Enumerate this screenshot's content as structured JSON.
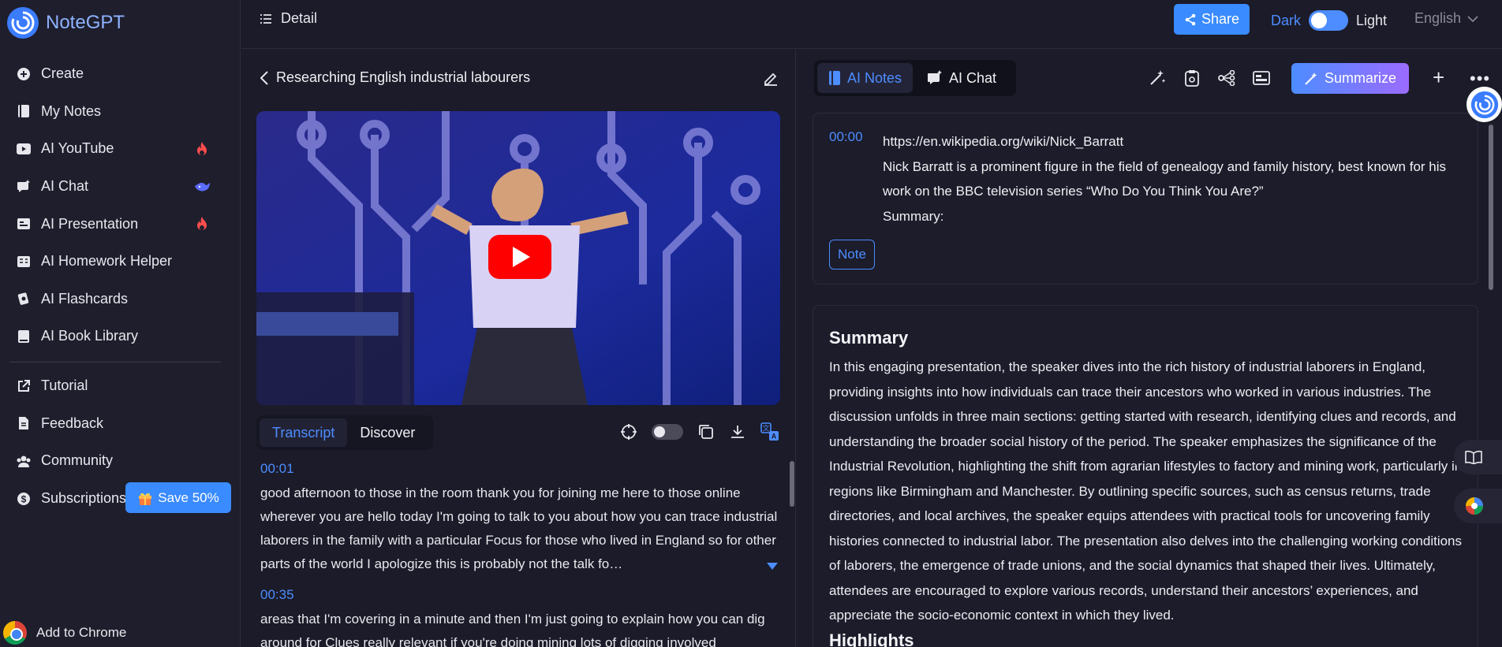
{
  "app": {
    "name": "NoteGPT"
  },
  "sidebar": {
    "items": [
      {
        "label": "Create",
        "icon": "plus-circle-icon"
      },
      {
        "label": "My Notes",
        "icon": "notebook-icon"
      },
      {
        "label": "AI YouTube",
        "icon": "youtube-icon",
        "badge": "fire-icon"
      },
      {
        "label": "AI Chat",
        "icon": "chat-icon",
        "badge": "whale-icon"
      },
      {
        "label": "AI Presentation",
        "icon": "presentation-icon",
        "badge": "fire-icon"
      },
      {
        "label": "AI Homework Helper",
        "icon": "homework-icon"
      },
      {
        "label": "AI Flashcards",
        "icon": "flashcards-icon"
      },
      {
        "label": "AI Book Library",
        "icon": "book-icon"
      }
    ],
    "secondary": [
      {
        "label": "Tutorial",
        "icon": "external-link-icon"
      },
      {
        "label": "Feedback",
        "icon": "document-icon"
      },
      {
        "label": "Community",
        "icon": "community-icon"
      },
      {
        "label": "Subscriptions",
        "icon": "dollar-icon"
      }
    ],
    "save_label": "Save 50%",
    "add_chrome": "Add to Chrome"
  },
  "topbar": {
    "title": "Detail",
    "share": "Share",
    "dark": "Dark",
    "light": "Light",
    "language": "English"
  },
  "video": {
    "title": "Researching English industrial labourers"
  },
  "left_tabs": {
    "transcript": "Transcript",
    "discover": "Discover"
  },
  "transcript": [
    {
      "time": "00:01",
      "text": "good afternoon to those in the room thank you for joining me here to those online wherever you are hello today I'm going to talk to you about how you can trace in­dustrial laborers in the family with a particular Focus for those who lived in England so for other parts of the world I apologize this is probably not the talk fo…"
    },
    {
      "time": "00:35",
      "text": "areas that I'm covering in a minute and then I'm just going to explain how you can dig around for Clues really relevant if you're doing mining lots of digging involved"
    }
  ],
  "right": {
    "tab_notes": "AI Notes",
    "tab_chat": "AI Chat",
    "summarize": "Summarize",
    "note_time": "00:00",
    "note_url": "https://en.wikipedia.org/wiki/Nick_Barratt",
    "note_line1": "Nick Barratt is a prominent figure in the field of genealogy and family history, best known for his work on the BBC television series “Who Do You Think You Are?”",
    "note_line2": "Summary:",
    "note_button": "Note",
    "summary_heading": "Summary",
    "summary_text": "In this engaging presentation, the speaker dives into the rich history of industrial laborers in England, providing insights into how individuals can trace their ancestors who worked in various industries. The discussion unfolds in three main sections: getting started with research, identifying clues and records, and understanding the broader social history of the period. The speaker emphasizes the significance of the Industrial Revolution, highlighting the shift from agrarian lifestyles to factory and mining work, partic­ularly in regions like Birmingham and Manchester. By outlining specific sources, such as census re­turns, trade directories, and local archives, the speaker equips attendees with practical tools for uncov­ering family histories connected to industrial labor. The presentation also delves into the challenging working conditions of laborers, the emergence of trade unions, and the social dynamics that shaped their lives. Ultimately, attendees are encouraged to explore various records, understand their ancestors’ experiences, and appreciate the socio-economic context in which they lived.",
    "highlights_heading": "Highlights"
  },
  "colors": {
    "accent": "#4d8dff",
    "background": "#1b1b29",
    "sidebar": "#1e1e2d",
    "danger": "#ff4d4d"
  }
}
